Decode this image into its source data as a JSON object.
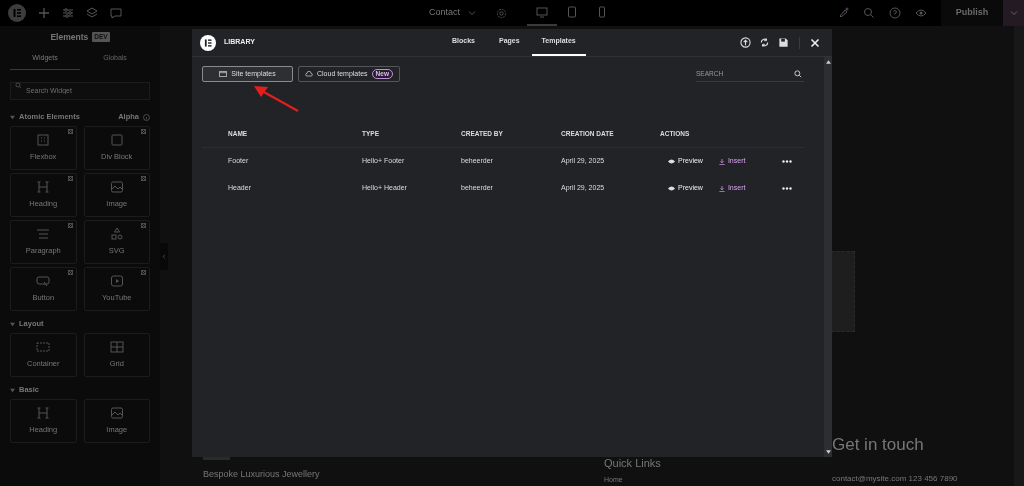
{
  "top_bar": {
    "page_title": "Contact",
    "devices": [
      {
        "kind": "desktop",
        "selected": true
      },
      {
        "kind": "tablet",
        "selected": false
      },
      {
        "kind": "mobile",
        "selected": false
      }
    ],
    "publish": "Publish"
  },
  "sidebar": {
    "title": "Elements",
    "badge": "DEV",
    "tabs": [
      {
        "label": "Widgets",
        "selected": true
      },
      {
        "label": "Globals",
        "selected": false
      }
    ],
    "search": {
      "placeholder": "Search Widget"
    },
    "sections": [
      {
        "title": "Atomic Elements",
        "tag": "Alpha",
        "expanded": true,
        "widgets": [
          {
            "label": "Flexbox",
            "kind": "flexbox",
            "locked": true
          },
          {
            "label": "Div Block",
            "kind": "block",
            "locked": true
          },
          {
            "label": "Heading",
            "kind": "heading",
            "locked": true
          },
          {
            "label": "Image",
            "kind": "image",
            "locked": true
          },
          {
            "label": "Paragraph",
            "kind": "paragraph",
            "locked": true
          },
          {
            "label": "SVG",
            "kind": "shapes",
            "locked": true
          },
          {
            "label": "Button",
            "kind": "button",
            "locked": true
          },
          {
            "label": "YouTube",
            "kind": "video",
            "locked": true
          }
        ]
      },
      {
        "title": "Layout",
        "expanded": true,
        "widgets": [
          {
            "label": "Container",
            "kind": "container",
            "locked": false
          },
          {
            "label": "Grid",
            "kind": "grid",
            "locked": false
          }
        ]
      },
      {
        "title": "Basic",
        "expanded": true,
        "widgets": [
          {
            "label": "Heading",
            "kind": "heading",
            "locked": false
          },
          {
            "label": "Image",
            "kind": "image",
            "locked": false
          }
        ]
      }
    ]
  },
  "canvas": {
    "tagline": "Bespoke Luxurious Jewellery",
    "links_title": "Quick Links",
    "links": [
      "Home"
    ],
    "contact_title": "Get in touch",
    "contact": "contact@mysite.com 123 456 7890"
  },
  "library": {
    "title": "LIBRARY",
    "tabs": [
      {
        "label": "Blocks",
        "selected": false
      },
      {
        "label": "Pages",
        "selected": false
      },
      {
        "label": "Templates",
        "selected": true
      }
    ],
    "sources": [
      {
        "label": "Site templates",
        "kind": "site",
        "selected": true
      },
      {
        "label": "Cloud templates",
        "kind": "cloud",
        "badge": "New",
        "selected": false
      }
    ],
    "search": {
      "placeholder": "SEARCH"
    },
    "table": {
      "columns": [
        "NAME",
        "TYPE",
        "CREATED BY",
        "CREATION DATE",
        "ACTIONS"
      ],
      "rows": [
        {
          "name": "Footer",
          "type": "Hello+ Footer",
          "created_by": "beheerder",
          "date": "April 29, 2025",
          "preview": "Preview",
          "insert": "Insert"
        },
        {
          "name": "Header",
          "type": "Hello+ Header",
          "created_by": "beheerder",
          "date": "April 29, 2025",
          "preview": "Preview",
          "insert": "Insert"
        }
      ]
    }
  }
}
